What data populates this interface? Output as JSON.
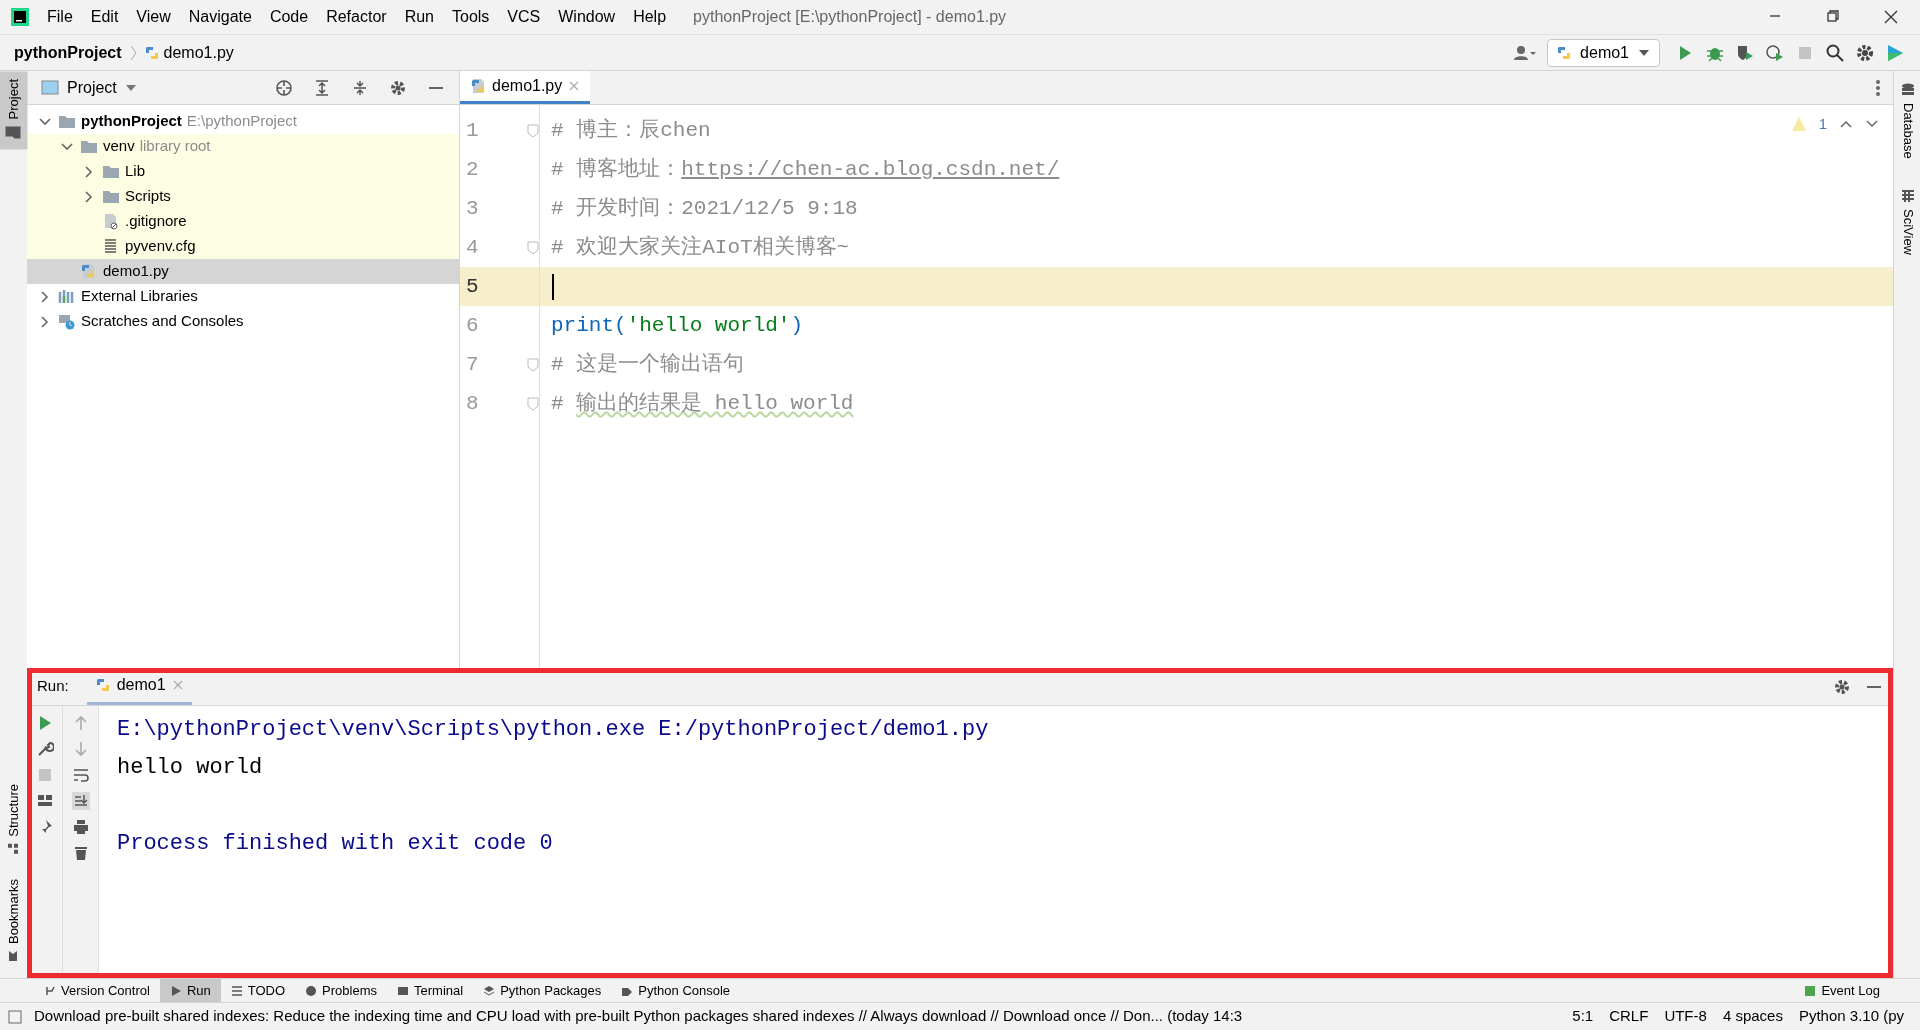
{
  "menu": [
    "File",
    "Edit",
    "View",
    "Navigate",
    "Code",
    "Refactor",
    "Run",
    "Tools",
    "VCS",
    "Window",
    "Help"
  ],
  "window_title": "pythonProject [E:\\pythonProject] - demo1.py",
  "breadcrumb": [
    "pythonProject",
    "demo1.py"
  ],
  "run_config": "demo1",
  "left_stripe": {
    "top": [
      {
        "label": "Project",
        "selected": true
      }
    ],
    "bottom": [
      {
        "label": "Structure",
        "selected": false
      },
      {
        "label": "Bookmarks",
        "selected": false
      }
    ]
  },
  "right_stripe": [
    {
      "label": "Database",
      "selected": false
    },
    {
      "label": "SciView",
      "selected": false
    }
  ],
  "project_panel": {
    "title": "Project",
    "tree": [
      {
        "label": "pythonProject",
        "hint": "E:\\pythonProject",
        "kind": "root",
        "expanded": true,
        "selected": false,
        "children": [
          {
            "label": "venv",
            "hint": "library root",
            "kind": "folder",
            "library": true,
            "expanded": true,
            "selected": false,
            "children": [
              {
                "label": "Lib",
                "kind": "folder",
                "expanded": false,
                "selected": false
              },
              {
                "label": "Scripts",
                "kind": "folder",
                "expanded": false,
                "selected": false
              },
              {
                "label": ".gitignore",
                "kind": "ignore",
                "selected": false
              },
              {
                "label": "pyvenv.cfg",
                "kind": "cfg",
                "selected": false
              }
            ]
          },
          {
            "label": "demo1.py",
            "kind": "python",
            "selected": true
          }
        ]
      },
      {
        "label": "External Libraries",
        "kind": "libraries",
        "expanded": false,
        "selected": false
      },
      {
        "label": "Scratches and Consoles",
        "kind": "scratches",
        "expanded": false,
        "selected": false
      }
    ]
  },
  "editor": {
    "tabs": [
      {
        "label": "demo1.py",
        "selected": true
      }
    ],
    "warning_count": "1",
    "lines": [
      {
        "number": "1",
        "current": false,
        "fold": true,
        "segments": [
          {
            "kind": "comment",
            "text": "# 博主：辰chen"
          }
        ]
      },
      {
        "number": "2",
        "current": false,
        "fold": false,
        "segments": [
          {
            "kind": "comment",
            "text": "# 博客地址："
          },
          {
            "kind": "link",
            "text": "https://chen-ac.blog.csdn.net/"
          }
        ]
      },
      {
        "number": "3",
        "current": false,
        "fold": false,
        "segments": [
          {
            "kind": "comment",
            "text": "# 开发时间：2021/12/5 9:18"
          }
        ]
      },
      {
        "number": "4",
        "current": false,
        "fold": true,
        "segments": [
          {
            "kind": "comment",
            "text": "# 欢迎大家关注AIoT相关博客~"
          }
        ]
      },
      {
        "number": "5",
        "current": true,
        "fold": false
      },
      {
        "number": "6",
        "current": false,
        "fold": false,
        "segments": [
          {
            "kind": "func",
            "text": "print("
          },
          {
            "kind": "string",
            "text": "'hello world'"
          },
          {
            "kind": "func",
            "text": ")"
          }
        ]
      },
      {
        "number": "7",
        "current": false,
        "fold": true,
        "segments": [
          {
            "kind": "comment",
            "text": "# 这是一个输出语句"
          }
        ]
      },
      {
        "number": "8",
        "current": false,
        "fold": true,
        "segments": [
          {
            "kind": "comment",
            "text": "# "
          },
          {
            "kind": "typo",
            "text": "输出的结果是 hello world"
          }
        ]
      }
    ]
  },
  "run_panel": {
    "highlighted": true,
    "label": "Run:",
    "tabs": [
      {
        "label": "demo1",
        "selected": true
      }
    ],
    "output": [
      {
        "kind": "system",
        "text": "E:\\pythonProject\\venv\\Scripts\\python.exe E:/pythonProject/demo1.py"
      },
      {
        "kind": "stdout",
        "text": "hello world"
      },
      {
        "kind": "blank"
      },
      {
        "kind": "system",
        "text": "Process finished with exit code 0"
      }
    ]
  },
  "tool_tabs": [
    {
      "label": "Version Control",
      "selected": false
    },
    {
      "label": "Run",
      "selected": true
    },
    {
      "label": "TODO",
      "selected": false
    },
    {
      "label": "Problems",
      "selected": false
    },
    {
      "label": "Terminal",
      "selected": false
    },
    {
      "label": "Python Packages",
      "selected": false
    },
    {
      "label": "Python Console",
      "selected": false
    }
  ],
  "event_log": "Event Log",
  "status_bar": {
    "message": "Download pre-built shared indexes: Reduce the indexing time and CPU load with pre-built Python packages shared indexes // Always download // Download once // Don... (today 14:3",
    "items": [
      "5:1",
      "CRLF",
      "UTF-8",
      "4 spaces",
      "Python 3.10 (py"
    ]
  }
}
